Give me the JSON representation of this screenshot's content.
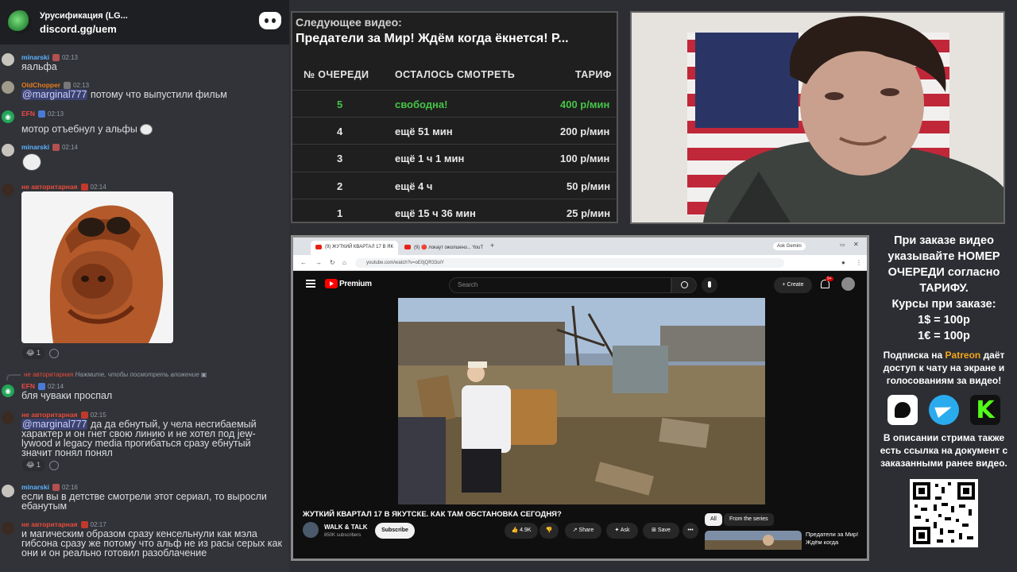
{
  "chat": {
    "server_title": "Урусификация (LG...",
    "server_link": "discord.gg/uem",
    "messages": [
      {
        "user": "minarski",
        "time": "02:13",
        "color": "#5db2ff",
        "text": "яальфа"
      },
      {
        "user": "OldChopper",
        "time": "02:13",
        "color": "#e67e22",
        "mention": "@marginal777",
        "text": " потому что выпустили фильм"
      },
      {
        "user": "EFN",
        "time": "02:13",
        "color": "#f04747",
        "text": "мотор отъебнул у альфы"
      },
      {
        "user": "minarski",
        "time": "02:14",
        "color": "#5db2ff",
        "text": ""
      },
      {
        "user": "не авторитарная",
        "time": "02:14",
        "color": "#e74c3c",
        "text": ""
      },
      {
        "user": "EFN",
        "time": "02:14",
        "color": "#f04747",
        "text": "бля чуваки проспал"
      },
      {
        "user": "не авторитарная",
        "time": "02:15",
        "color": "#e74c3c",
        "mention": "@marginal777",
        "text": " да да ебнутый, у чела несгибаемый характер и он гнет свою линию и не хотел под jew-lywood и legacy media прогибаться сразу ебнутый значит понял понял"
      },
      {
        "user": "minarski",
        "time": "02:16",
        "color": "#5db2ff",
        "text": "если вы в детстве смотрели этот сериал, то выросли ебанутым"
      },
      {
        "user": "не авторитарная",
        "time": "02:17",
        "color": "#e74c3c",
        "text": "и магическим образом сразу кенсельнули как мэла гибсона сразу же потому что альф не из расы серых как они и он реально готовил разоблачение"
      }
    ],
    "reply_hint": "Нажмите, чтобы посмотреть вложение",
    "reply_user": "не авторитарная",
    "reaction_count_1": "1",
    "reaction_count_2": "1"
  },
  "queue": {
    "next_label": "Следующее видео:",
    "next_title": "Предатели за Мир! Ждём когда ёкнется! Р...",
    "headers": {
      "num": "№ ОЧЕРЕДИ",
      "left": "ОСТАЛОСЬ СМОТРЕТЬ",
      "rate": "ТАРИФ"
    },
    "rows": [
      {
        "num": "5",
        "left": "свободна!",
        "rate": "400 р/мин"
      },
      {
        "num": "4",
        "left": "ещё 51 мин",
        "rate": "200 р/мин"
      },
      {
        "num": "3",
        "left": "ещё 1 ч 1 мин",
        "rate": "100 р/мин"
      },
      {
        "num": "2",
        "left": "ещё 4 ч",
        "rate": "50 р/мин"
      },
      {
        "num": "1",
        "left": "ещё 15 ч 36 мин",
        "rate": "25 р/мин"
      }
    ]
  },
  "browser": {
    "tab1": "(9) ЖУТКИЙ КВАРТАЛ 17 В ЯК",
    "tab2": "(9) 🔴 локаут ожолшенз... YouT",
    "gemini": "Ask Gemini",
    "url": "youtube.com/watch?v=oE0jQR33oiY",
    "brand": "Premium",
    "search_placeholder": "Search",
    "create": "+ Create",
    "notif_count": "9+",
    "video_title": "ЖУТКИЙ КВАРТАЛ 17 В ЯКУТСКЕ. КАК ТАМ ОБСТАНОВКА СЕГОДНЯ?",
    "channel": "WALK & TALK",
    "subs": "850K subscribers",
    "subscribe": "Subscribe",
    "likes": "👍 4.9K",
    "dislike": "👎",
    "share": "↗ Share",
    "ask": "✦ Ask",
    "save": "⊞ Save",
    "more": "•••",
    "chip_all": "All",
    "chip_series": "From the series",
    "rec_title": "Предатели за Мир! Ждём когда"
  },
  "info": {
    "main": "При заказе видео указывайте НОМЕР ОЧЕРЕДИ согласно ТАРИФУ.",
    "courses": "Курсы при заказе:",
    "usd": "1$ = 100р",
    "eur": "1€ = 100р",
    "sub_pre": "Подписка на ",
    "patreon": "Patreon",
    "sub_post": " даёт доступ к чату на экране и голосованиям за видео!",
    "desc": "В описании стрима также есть ссылка на документ с заказанными ранее видео."
  },
  "colors": {
    "free": "#45c547",
    "patreon": "#f3a51c",
    "telegram": "#2aabee",
    "kick": "#53fc18"
  }
}
